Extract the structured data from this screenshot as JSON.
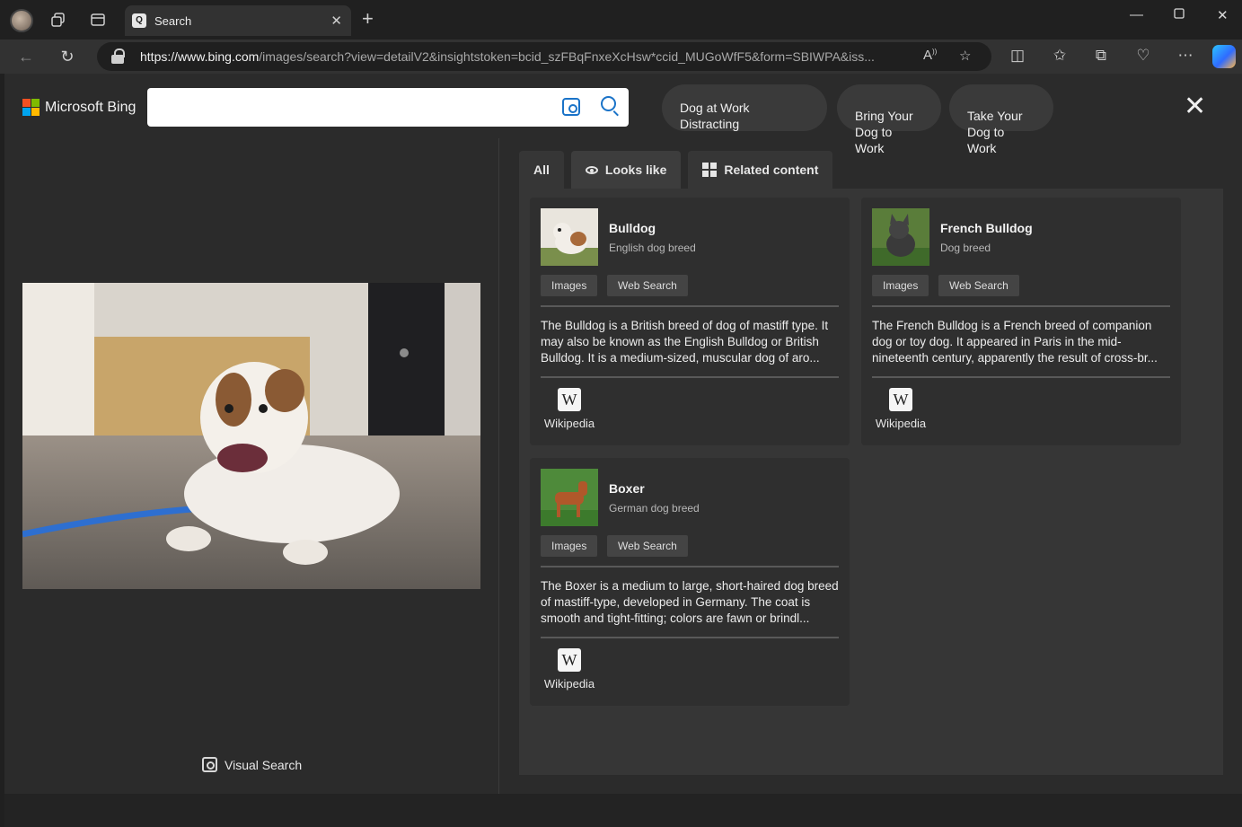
{
  "browser": {
    "tab_title": "Search",
    "url_host": "https://www.bing.com",
    "url_path": "/images/search?view=detailV2&insightstoken=bcid_szFBqFnxeXcHsw*ccid_MUGoWfF5&form=SBIWPA&iss..."
  },
  "bing": {
    "logo_text": "Microsoft Bing",
    "search_value": "",
    "chips": [
      "Dog at Work Distracting",
      "Bring Your\nDog to Work",
      "Take Your\nDog to Work"
    ]
  },
  "tabs": [
    {
      "label": "All"
    },
    {
      "label": "Looks like"
    },
    {
      "label": "Related content"
    }
  ],
  "visual_search_label": "Visual Search",
  "cards": [
    {
      "title": "Bulldog",
      "subtitle": "English dog breed",
      "btn_images": "Images",
      "btn_web": "Web Search",
      "description": "The Bulldog is a British breed of dog of mastiff type. It may also be known as the English Bulldog or British Bulldog. It is a medium-sized, muscular dog of aro...",
      "source": "Wikipedia"
    },
    {
      "title": "French Bulldog",
      "subtitle": "Dog breed",
      "btn_images": "Images",
      "btn_web": "Web Search",
      "description": "The French Bulldog is a French breed of companion dog or toy dog. It appeared in Paris in the mid-nineteenth century, apparently the result of cross-br...",
      "source": "Wikipedia"
    },
    {
      "title": "Boxer",
      "subtitle": "German dog breed",
      "btn_images": "Images",
      "btn_web": "Web Search",
      "description": "The Boxer is a medium to large, short-haired dog breed of mastiff-type, developed in Germany. The coat is smooth and tight-fitting; colors are fawn or brindl...",
      "source": "Wikipedia"
    }
  ],
  "colors": {
    "accent": "#1a73c8",
    "page_bg": "#2b2b2b",
    "panel_bg": "#363636"
  }
}
